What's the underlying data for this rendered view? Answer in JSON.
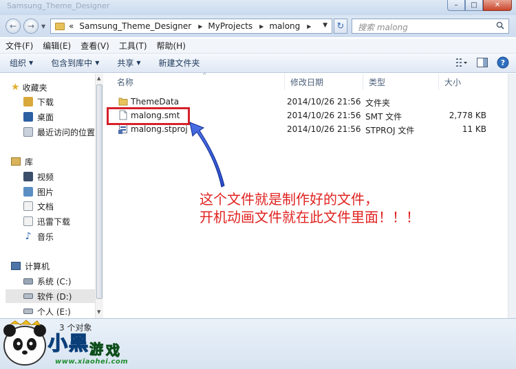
{
  "window": {
    "title": "Samsung_Theme_Designer"
  },
  "address": {
    "crumbs": [
      "Samsung_Theme_Designer",
      "MyProjects",
      "malong"
    ],
    "overflow": "«",
    "search_placeholder": "搜索 malong"
  },
  "menu": [
    "文件(F)",
    "编辑(E)",
    "查看(V)",
    "工具(T)",
    "帮助(H)"
  ],
  "toolbar": {
    "organize": "组织",
    "include_library": "包含到库中",
    "share": "共享",
    "new_folder": "新建文件夹"
  },
  "nav": {
    "favorites": "收藏夹",
    "favorites_items": [
      "下载",
      "桌面",
      "最近访问的位置"
    ],
    "libraries": "库",
    "library_items": [
      "视频",
      "图片",
      "文档",
      "迅雷下载",
      "音乐"
    ],
    "computer": "计算机",
    "drives": [
      "系统 (C:)",
      "软件 (D:)",
      "个人 (E:)"
    ]
  },
  "columns": {
    "name": "名称",
    "modified": "修改日期",
    "type": "类型",
    "size": "大小"
  },
  "files": [
    {
      "name": "ThemeData",
      "modified": "2014/10/26 21:56",
      "type": "文件夹",
      "size": "",
      "icon": "folder-icon"
    },
    {
      "name": "malong.smt",
      "modified": "2014/10/26 21:56",
      "type": "SMT 文件",
      "size": "2,778 KB",
      "icon": "file-icon"
    },
    {
      "name": "malong.stproj",
      "modified": "2014/10/26 21:56",
      "type": "STPROJ 文件",
      "size": "11 KB",
      "icon": "project-file-icon"
    }
  ],
  "annotation": {
    "line1": "这个文件就是制作好的文件，",
    "line2": "开机动画文件就在此文件里面！！！",
    "color": "#e0221f"
  },
  "status": {
    "count": "3 个对象"
  },
  "watermark": {
    "brand": "小黑游戏",
    "site": "www.xiaohei.com"
  }
}
